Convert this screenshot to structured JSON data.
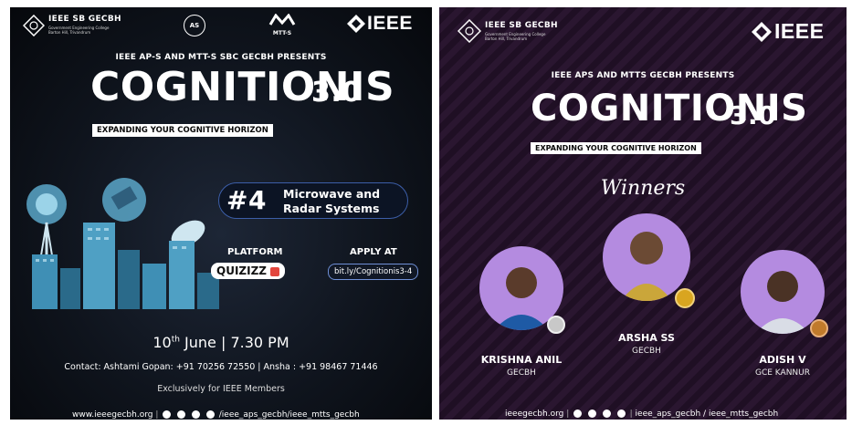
{
  "left": {
    "org_name": "IEEE SB GECBH",
    "org_sub1": "Government Engineering College",
    "org_sub2": "Barton Hill, Trivandrum",
    "aps_logo": "AS",
    "mtts_logo": "MTT-S",
    "ieee_logo": "IEEE",
    "presents": "IEEE AP-S AND MTT-S SBC GECBH PRESENTS",
    "title": "COGNITIONIS",
    "version": "3.0",
    "tagline": "EXPANDING YOUR COGNITIVE HORIZON",
    "episode_num": "#4",
    "episode_title_1": "Microwave and",
    "episode_title_2": "Radar Systems",
    "platform_label": "PLATFORM",
    "platform_name": "QUIZIZZ",
    "apply_label": "APPLY AT",
    "apply_link": "bit.ly/Cognitionis3-4",
    "date_day": "10",
    "date_sup": "th",
    "date_rest": " June | 7.30 PM",
    "contact": "Contact: Ashtami Gopan: +91 70256 72550 | Ansha : +91 98467 71446",
    "exclusive": "Exclusively for IEEE Members",
    "website": "www.ieeegecbh.org",
    "handles": "/ieee_aps_gecbh/ieee_mtts_gecbh"
  },
  "right": {
    "org_name": "IEEE SB GECBH",
    "org_sub1": "Government Engineering College",
    "org_sub2": "Barton Hill, Trivandrum",
    "ieee_logo": "IEEE",
    "presents": "IEEE APS AND MTTS GECBH  PRESENTS",
    "title": "COGNITIONIS",
    "version": "3.0",
    "tagline": "EXPANDING YOUR COGNITIVE HORIZON",
    "winners": "Winners",
    "w1_name": "KRISHNA ANIL",
    "w1_inst": "GECBH",
    "w2_name": "ARSHA SS",
    "w2_inst": "GECBH",
    "w3_name": "ADISH V",
    "w3_inst": "GCE KANNUR",
    "website": "ieeegecbh.org",
    "handles": "ieee_aps_gecbh / ieee_mtts_gecbh"
  },
  "colors": {
    "accent_blue": "#3c5ea8",
    "purple": "#b48be0",
    "gold": "#d9a520",
    "silver": "#c8c8c8",
    "bronze": "#c07a2b"
  }
}
